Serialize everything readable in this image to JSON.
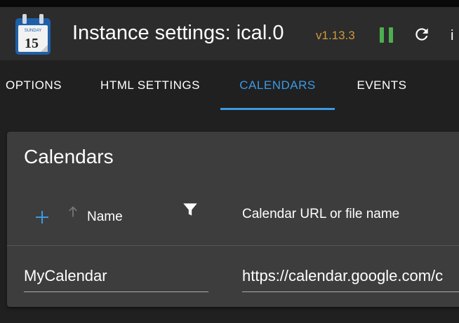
{
  "header": {
    "app_icon": "calendar-icon",
    "calendar_day_label": "SUNDAY",
    "calendar_day_number": "15",
    "title": "Instance settings: ical.0",
    "version": "v1.13.3",
    "pause_icon": "pause-icon",
    "reload_icon": "reload-icon",
    "cut_text": "i",
    "colors": {
      "version": "#d0993a",
      "pause": "#4caf50",
      "accent": "#3a9ae6"
    }
  },
  "tabs": [
    {
      "label": "OPTIONS",
      "active": false
    },
    {
      "label": "HTML SETTINGS",
      "active": false
    },
    {
      "label": "CALENDARS",
      "active": true
    },
    {
      "label": "EVENTS",
      "active": false
    }
  ],
  "calendars": {
    "title": "Calendars",
    "columns": {
      "name": "Name",
      "url": "Calendar URL or file name"
    },
    "icons": [
      "add-icon",
      "sort-arrow-up-icon",
      "filter-icon"
    ],
    "rows": [
      {
        "name": "MyCalendar",
        "url": "https://calendar.google.com/c"
      }
    ]
  }
}
